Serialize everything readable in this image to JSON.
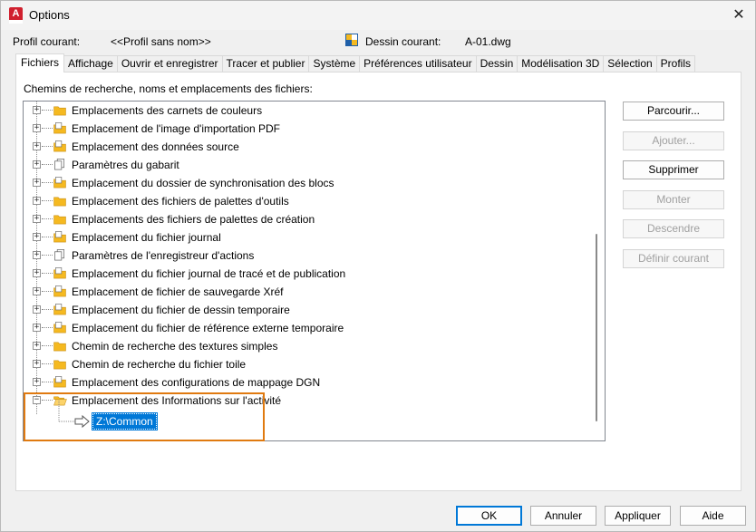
{
  "window": {
    "title": "Options",
    "close_glyph": "✕"
  },
  "profile": {
    "label": "Profil courant:",
    "value": "<<Profil sans nom>>",
    "drawing_label": "Dessin courant:",
    "drawing_value": "A-01.dwg"
  },
  "tabs": [
    "Fichiers",
    "Affichage",
    "Ouvrir et enregistrer",
    "Tracer et publier",
    "Système",
    "Préférences utilisateur",
    "Dessin",
    "Modélisation 3D",
    "Sélection",
    "Profils"
  ],
  "active_tab": "Fichiers",
  "panel": {
    "section_label": "Chemins de recherche, noms et emplacements des fichiers:",
    "tree_items": [
      {
        "label": "Emplacements des carnets de couleurs",
        "icon": "folder-icon"
      },
      {
        "label": "Emplacement de l'image d'importation PDF",
        "icon": "folder-file-icon"
      },
      {
        "label": "Emplacement des données source",
        "icon": "folder-file-icon"
      },
      {
        "label": "Paramètres du gabarit",
        "icon": "documents-icon"
      },
      {
        "label": "Emplacement du dossier de synchronisation des blocs",
        "icon": "folder-file-icon"
      },
      {
        "label": "Emplacement des fichiers de palettes d'outils",
        "icon": "folder-icon"
      },
      {
        "label": "Emplacements des fichiers de palettes de création",
        "icon": "folder-icon"
      },
      {
        "label": "Emplacement du fichier journal",
        "icon": "folder-file-icon"
      },
      {
        "label": "Paramètres de l'enregistreur d'actions",
        "icon": "documents-icon"
      },
      {
        "label": "Emplacement du fichier journal de tracé et de publication",
        "icon": "folder-file-icon"
      },
      {
        "label": "Emplacement de fichier de sauvegarde Xréf",
        "icon": "folder-file-icon"
      },
      {
        "label": "Emplacement du fichier de dessin temporaire",
        "icon": "folder-file-icon"
      },
      {
        "label": "Emplacement du fichier de référence externe temporaire",
        "icon": "folder-file-icon"
      },
      {
        "label": "Chemin de recherche des textures simples",
        "icon": "folder-icon"
      },
      {
        "label": "Chemin de recherche du fichier toile",
        "icon": "folder-icon"
      },
      {
        "label": "Emplacement des configurations de mappage DGN",
        "icon": "folder-file-icon"
      },
      {
        "label": "Emplacement des Informations sur l'activité",
        "icon": "folder-open-icon",
        "expanded": true
      }
    ],
    "selected_path": "Z:\\Common"
  },
  "side_buttons": {
    "browse": "Parcourir...",
    "add": "Ajouter...",
    "remove": "Supprimer",
    "move_up": "Monter",
    "move_down": "Descendre",
    "set_current": "Définir courant"
  },
  "bottom_buttons": {
    "ok": "OK",
    "cancel": "Annuler",
    "apply": "Appliquer",
    "help": "Aide"
  },
  "colors": {
    "accent": "#0078d7",
    "highlight_box": "#e07a10",
    "folder": "#f5b920",
    "app_icon": "#d0202e"
  }
}
